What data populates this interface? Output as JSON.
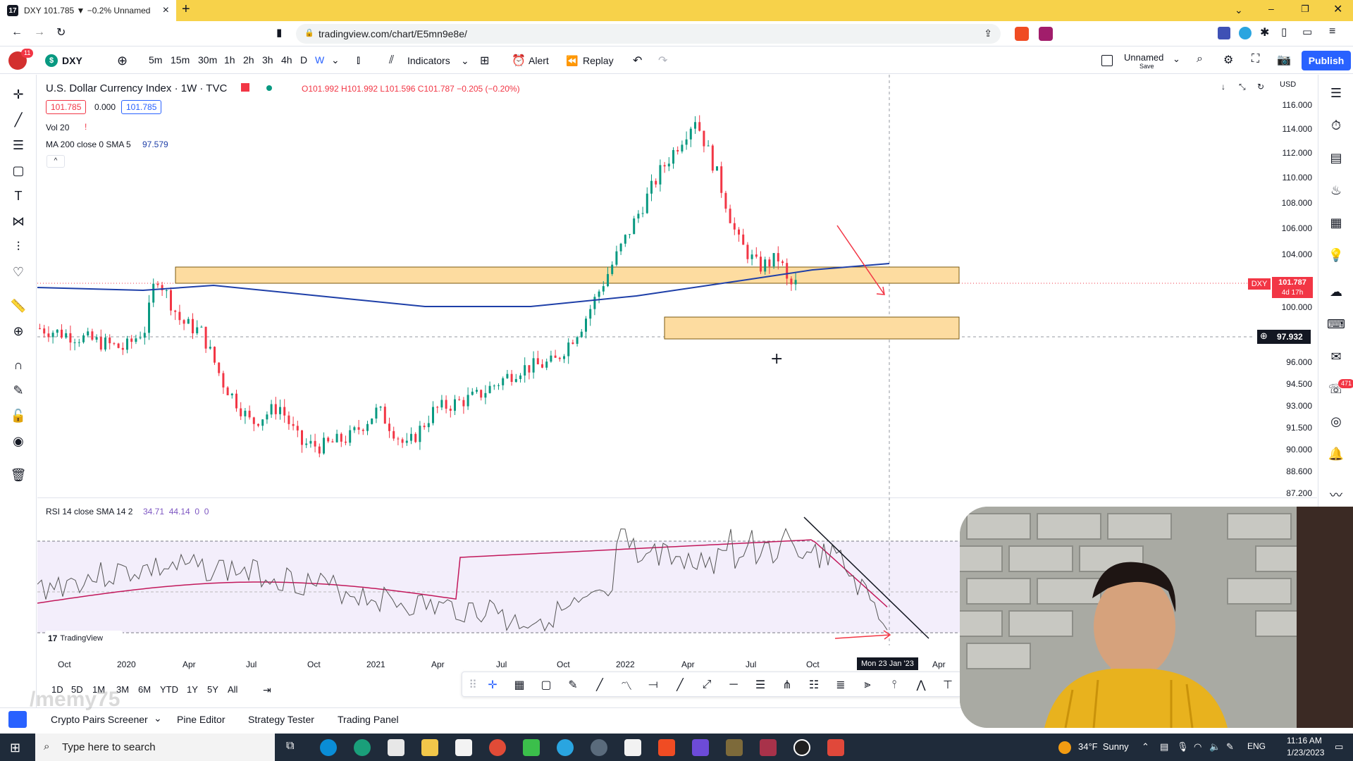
{
  "browser": {
    "tab_title": "DXY 101.785 ▼ −0.2% Unnamed",
    "url": "tradingview.com/chart/E5mn9e8e/",
    "new_tab": "+",
    "close": "×"
  },
  "toolbar": {
    "avatar_badge": "11",
    "symbol": "DXY",
    "timeframes": [
      "5m",
      "15m",
      "30m",
      "1h",
      "2h",
      "3h",
      "4h",
      "D",
      "W"
    ],
    "indicators": "Indicators",
    "alert": "Alert",
    "replay": "Replay",
    "layout_name": "Unnamed",
    "layout_sub": "Save",
    "publish": "Publish"
  },
  "legend": {
    "title": "U.S. Dollar Currency Index · 1W · TVC",
    "ohlc": "O101.992 H101.992 L101.596 C101.787 −0.205 (−0.20%)",
    "bid": "101.785",
    "spread": "0.000",
    "ask": "101.785",
    "vol": "Vol 20",
    "ma": "MA 200 close 0 SMA 5",
    "ma_value": "97.579",
    "currency": "USD"
  },
  "price_labels": [
    "116.000",
    "114.000",
    "112.000",
    "110.000",
    "108.000",
    "106.000",
    "104.000",
    "100.000",
    "96.000",
    "94.500",
    "93.000",
    "91.500",
    "90.000",
    "88.600",
    "87.200"
  ],
  "last_price": {
    "symbol": "DXY",
    "price": "101.787",
    "countdown": "4d 17h"
  },
  "crosshair_price": "97.932",
  "rsi": {
    "label": "RSI 14 close SMA 14 2",
    "values": "34.71  44.14  0  0"
  },
  "time_labels": [
    "Oct",
    "2020",
    "Apr",
    "Jul",
    "Oct",
    "2021",
    "Apr",
    "Jul",
    "Oct",
    "2022",
    "Apr",
    "Jul",
    "Oct",
    "Apr"
  ],
  "crosshair_time": "Mon 23 Jan '23",
  "watermark": "TradingView",
  "ranges": [
    "1D",
    "5D",
    "1M",
    "3M",
    "6M",
    "YTD",
    "1Y",
    "5Y",
    "All"
  ],
  "bottom_tabs": [
    "Crypto Pairs Screener",
    "Pine Editor",
    "Strategy Tester",
    "Trading Panel"
  ],
  "overlay_text": "/memy75",
  "taskbar": {
    "search_placeholder": "Type here to search",
    "weather": "34°F  Sunny",
    "lang": "ENG",
    "time": "11:16 AM",
    "date": "1/23/2023"
  },
  "badges": {
    "alerts": "471"
  },
  "colors": {
    "up": "#089981",
    "down": "#f23645",
    "zone": "#fddca0",
    "ma": "#1e3fa8",
    "rsi": "#555555",
    "rsi_ma": "#c2185b"
  }
}
